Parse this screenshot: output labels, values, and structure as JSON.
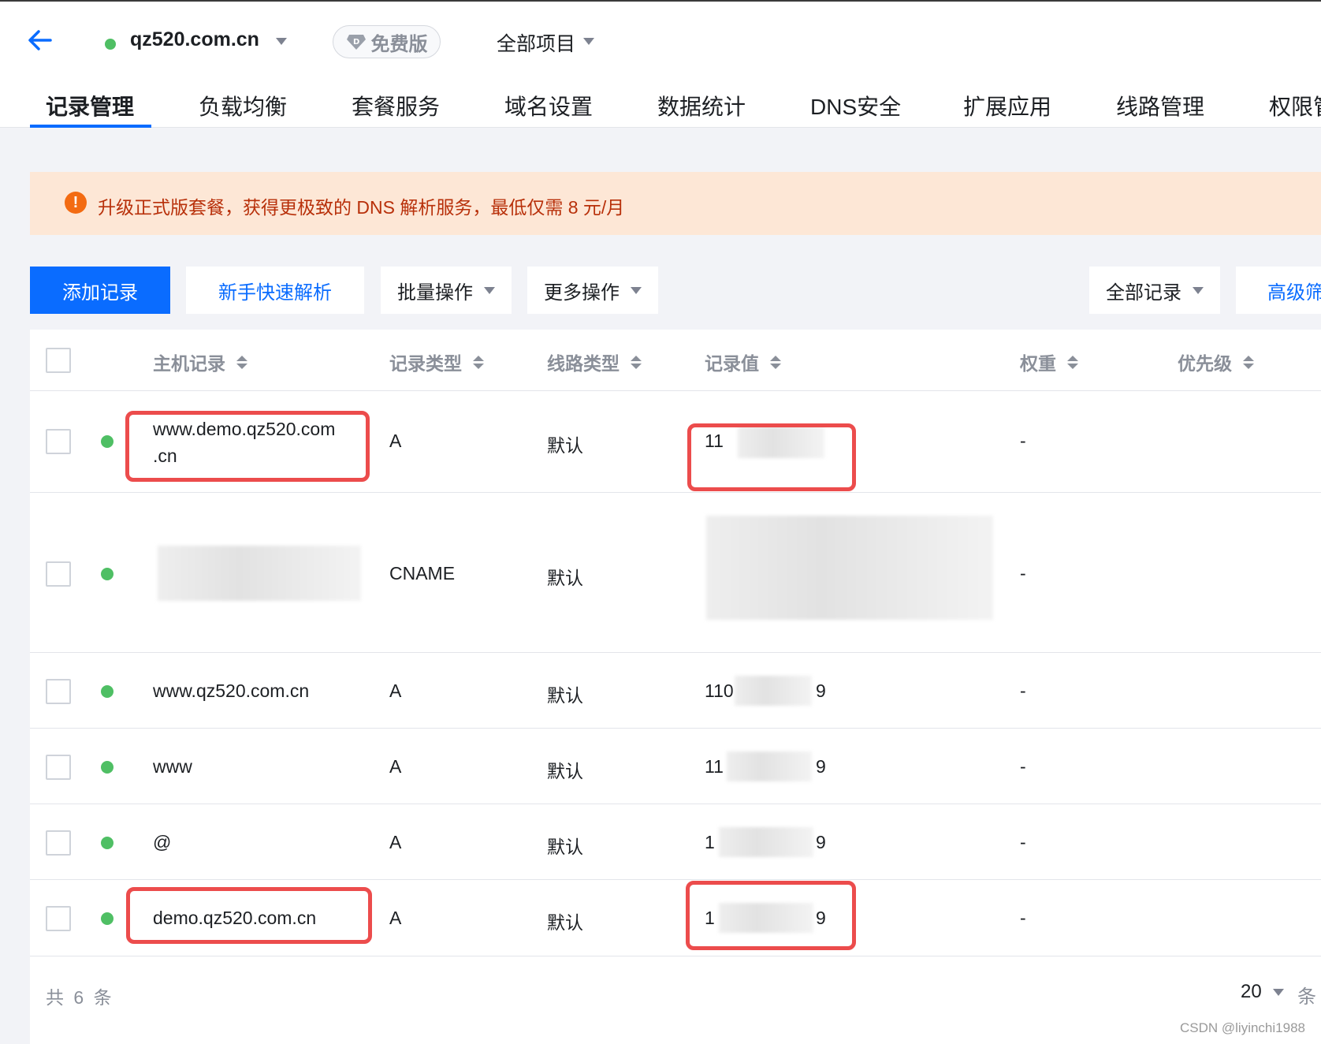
{
  "header": {
    "domain": "qz520.com.cn",
    "plan_badge": "免费版",
    "project": "全部项目"
  },
  "tabs": [
    {
      "label": "记录管理",
      "active": true
    },
    {
      "label": "负载均衡"
    },
    {
      "label": "套餐服务"
    },
    {
      "label": "域名设置"
    },
    {
      "label": "数据统计"
    },
    {
      "label": "DNS安全"
    },
    {
      "label": "扩展应用"
    },
    {
      "label": "线路管理"
    },
    {
      "label": "权限管"
    }
  ],
  "notice": {
    "text": "升级正式版套餐，获得更极致的 DNS 解析服务，最低仅需 8 元/月",
    "icon": "info-icon",
    "color": "#f36b12"
  },
  "toolbar": {
    "add_record": "添加记录",
    "quick_resolve": "新手快速解析",
    "batch_ops": "批量操作",
    "more_ops": "更多操作",
    "record_filter": "全部记录",
    "advanced_filter": "高级筛"
  },
  "table": {
    "columns": [
      "主机记录",
      "记录类型",
      "线路类型",
      "记录值",
      "权重",
      "优先级"
    ],
    "rows": [
      {
        "host_line1": "www.demo.qz520.com",
        "host_line2": ".cn",
        "type": "A",
        "line": "默认",
        "value": "11",
        "weight": "-",
        "highlighted": true
      },
      {
        "host": "",
        "type": "CNAME",
        "line": "默认",
        "value": "",
        "weight": "-",
        "highlighted": false
      },
      {
        "host": "www.qz520.com.cn",
        "type": "A",
        "line": "默认",
        "value_prefix": "110",
        "value_suffix": "9",
        "weight": "-",
        "highlighted": false
      },
      {
        "host": "www",
        "type": "A",
        "line": "默认",
        "value_prefix": "11",
        "value_suffix": "9",
        "weight": "-",
        "highlighted": false
      },
      {
        "host": "@",
        "type": "A",
        "line": "默认",
        "value_prefix": "1",
        "value_suffix": "9",
        "weight": "-",
        "highlighted": false
      },
      {
        "host": "demo.qz520.com.cn",
        "type": "A",
        "line": "默认",
        "value_prefix": "1",
        "value_suffix": "9",
        "weight": "-",
        "highlighted": true
      }
    ]
  },
  "footer": {
    "total": "共 6 条",
    "page_size": "20",
    "page_size_unit": "条"
  },
  "watermark": "CSDN @liyinchi1988",
  "colors": {
    "accent": "#0a6cff",
    "status_ok": "#4fbf64",
    "highlight_box": "#ec4c4c",
    "notice_bg": "#fde7d6"
  }
}
